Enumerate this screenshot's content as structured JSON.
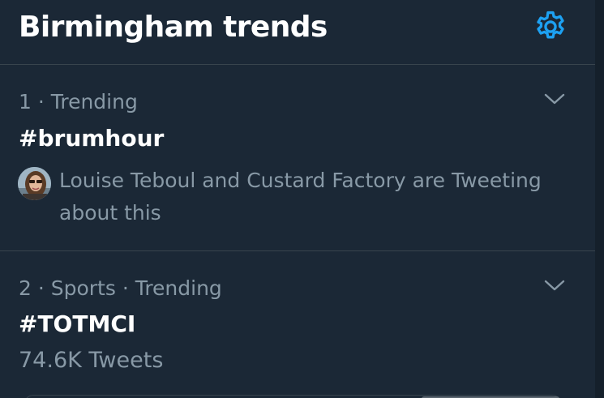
{
  "header": {
    "title": "Birmingham trends",
    "settings_icon": "gear-icon",
    "accent_color": "#1da1f2"
  },
  "trends": [
    {
      "rank": "1",
      "meta": "1 · Trending",
      "name": "#brumhour",
      "context": "Louise Teboul and Custard Factory are Tweeting about this",
      "menu_icon": "chevron-down-icon"
    },
    {
      "rank": "2",
      "meta": "2 · Sports · Trending",
      "name": "#TOTMCI",
      "tweet_count": "74.6K Tweets",
      "menu_icon": "chevron-down-icon"
    }
  ],
  "colors": {
    "background": "#1b2836",
    "secondary_text": "#8899a6",
    "divider": "#38444d"
  }
}
